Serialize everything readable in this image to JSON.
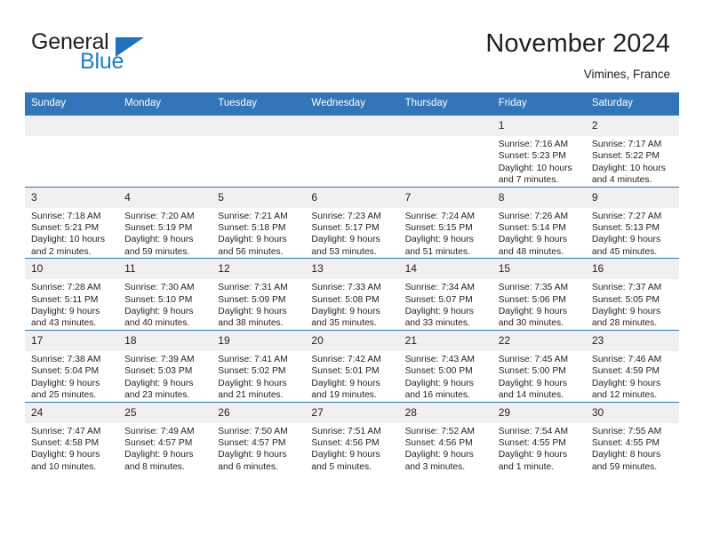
{
  "brand": {
    "word_one": "General",
    "word_two": "Blue",
    "logo_icon": "triangle-logo-icon"
  },
  "header": {
    "title": "November 2024",
    "subtitle": "Vimines, France"
  },
  "colors": {
    "header_blue": "#3275b8",
    "brand_blue": "#1b7fc4",
    "daynum_band": "#f0f0f0",
    "text": "#231f20"
  },
  "calendar": {
    "weekday_headers": [
      "Sunday",
      "Monday",
      "Tuesday",
      "Wednesday",
      "Thursday",
      "Friday",
      "Saturday"
    ],
    "weeks": [
      [
        {
          "day": "",
          "lines": [],
          "empty": true
        },
        {
          "day": "",
          "lines": [],
          "empty": true
        },
        {
          "day": "",
          "lines": [],
          "empty": true
        },
        {
          "day": "",
          "lines": [],
          "empty": true
        },
        {
          "day": "",
          "lines": [],
          "empty": true
        },
        {
          "day": "1",
          "lines": [
            "Sunrise: 7:16 AM",
            "Sunset: 5:23 PM",
            "Daylight: 10 hours",
            "and 7 minutes."
          ]
        },
        {
          "day": "2",
          "lines": [
            "Sunrise: 7:17 AM",
            "Sunset: 5:22 PM",
            "Daylight: 10 hours",
            "and 4 minutes."
          ]
        }
      ],
      [
        {
          "day": "3",
          "lines": [
            "Sunrise: 7:18 AM",
            "Sunset: 5:21 PM",
            "Daylight: 10 hours",
            "and 2 minutes."
          ]
        },
        {
          "day": "4",
          "lines": [
            "Sunrise: 7:20 AM",
            "Sunset: 5:19 PM",
            "Daylight: 9 hours",
            "and 59 minutes."
          ]
        },
        {
          "day": "5",
          "lines": [
            "Sunrise: 7:21 AM",
            "Sunset: 5:18 PM",
            "Daylight: 9 hours",
            "and 56 minutes."
          ]
        },
        {
          "day": "6",
          "lines": [
            "Sunrise: 7:23 AM",
            "Sunset: 5:17 PM",
            "Daylight: 9 hours",
            "and 53 minutes."
          ]
        },
        {
          "day": "7",
          "lines": [
            "Sunrise: 7:24 AM",
            "Sunset: 5:15 PM",
            "Daylight: 9 hours",
            "and 51 minutes."
          ]
        },
        {
          "day": "8",
          "lines": [
            "Sunrise: 7:26 AM",
            "Sunset: 5:14 PM",
            "Daylight: 9 hours",
            "and 48 minutes."
          ]
        },
        {
          "day": "9",
          "lines": [
            "Sunrise: 7:27 AM",
            "Sunset: 5:13 PM",
            "Daylight: 9 hours",
            "and 45 minutes."
          ]
        }
      ],
      [
        {
          "day": "10",
          "lines": [
            "Sunrise: 7:28 AM",
            "Sunset: 5:11 PM",
            "Daylight: 9 hours",
            "and 43 minutes."
          ]
        },
        {
          "day": "11",
          "lines": [
            "Sunrise: 7:30 AM",
            "Sunset: 5:10 PM",
            "Daylight: 9 hours",
            "and 40 minutes."
          ]
        },
        {
          "day": "12",
          "lines": [
            "Sunrise: 7:31 AM",
            "Sunset: 5:09 PM",
            "Daylight: 9 hours",
            "and 38 minutes."
          ]
        },
        {
          "day": "13",
          "lines": [
            "Sunrise: 7:33 AM",
            "Sunset: 5:08 PM",
            "Daylight: 9 hours",
            "and 35 minutes."
          ]
        },
        {
          "day": "14",
          "lines": [
            "Sunrise: 7:34 AM",
            "Sunset: 5:07 PM",
            "Daylight: 9 hours",
            "and 33 minutes."
          ]
        },
        {
          "day": "15",
          "lines": [
            "Sunrise: 7:35 AM",
            "Sunset: 5:06 PM",
            "Daylight: 9 hours",
            "and 30 minutes."
          ]
        },
        {
          "day": "16",
          "lines": [
            "Sunrise: 7:37 AM",
            "Sunset: 5:05 PM",
            "Daylight: 9 hours",
            "and 28 minutes."
          ]
        }
      ],
      [
        {
          "day": "17",
          "lines": [
            "Sunrise: 7:38 AM",
            "Sunset: 5:04 PM",
            "Daylight: 9 hours",
            "and 25 minutes."
          ]
        },
        {
          "day": "18",
          "lines": [
            "Sunrise: 7:39 AM",
            "Sunset: 5:03 PM",
            "Daylight: 9 hours",
            "and 23 minutes."
          ]
        },
        {
          "day": "19",
          "lines": [
            "Sunrise: 7:41 AM",
            "Sunset: 5:02 PM",
            "Daylight: 9 hours",
            "and 21 minutes."
          ]
        },
        {
          "day": "20",
          "lines": [
            "Sunrise: 7:42 AM",
            "Sunset: 5:01 PM",
            "Daylight: 9 hours",
            "and 19 minutes."
          ]
        },
        {
          "day": "21",
          "lines": [
            "Sunrise: 7:43 AM",
            "Sunset: 5:00 PM",
            "Daylight: 9 hours",
            "and 16 minutes."
          ]
        },
        {
          "day": "22",
          "lines": [
            "Sunrise: 7:45 AM",
            "Sunset: 5:00 PM",
            "Daylight: 9 hours",
            "and 14 minutes."
          ]
        },
        {
          "day": "23",
          "lines": [
            "Sunrise: 7:46 AM",
            "Sunset: 4:59 PM",
            "Daylight: 9 hours",
            "and 12 minutes."
          ]
        }
      ],
      [
        {
          "day": "24",
          "lines": [
            "Sunrise: 7:47 AM",
            "Sunset: 4:58 PM",
            "Daylight: 9 hours",
            "and 10 minutes."
          ]
        },
        {
          "day": "25",
          "lines": [
            "Sunrise: 7:49 AM",
            "Sunset: 4:57 PM",
            "Daylight: 9 hours",
            "and 8 minutes."
          ]
        },
        {
          "day": "26",
          "lines": [
            "Sunrise: 7:50 AM",
            "Sunset: 4:57 PM",
            "Daylight: 9 hours",
            "and 6 minutes."
          ]
        },
        {
          "day": "27",
          "lines": [
            "Sunrise: 7:51 AM",
            "Sunset: 4:56 PM",
            "Daylight: 9 hours",
            "and 5 minutes."
          ]
        },
        {
          "day": "28",
          "lines": [
            "Sunrise: 7:52 AM",
            "Sunset: 4:56 PM",
            "Daylight: 9 hours",
            "and 3 minutes."
          ]
        },
        {
          "day": "29",
          "lines": [
            "Sunrise: 7:54 AM",
            "Sunset: 4:55 PM",
            "Daylight: 9 hours",
            "and 1 minute."
          ]
        },
        {
          "day": "30",
          "lines": [
            "Sunrise: 7:55 AM",
            "Sunset: 4:55 PM",
            "Daylight: 8 hours",
            "and 59 minutes."
          ]
        }
      ]
    ]
  }
}
